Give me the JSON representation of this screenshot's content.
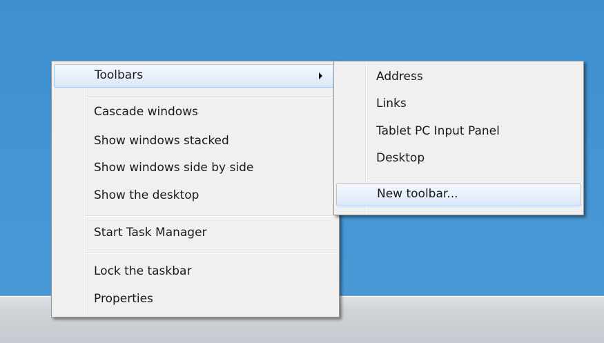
{
  "context_menu": {
    "items": [
      {
        "label": "Toolbars"
      },
      {
        "label": "Cascade windows"
      },
      {
        "label": "Show windows stacked"
      },
      {
        "label": "Show windows side by side"
      },
      {
        "label": "Show the desktop"
      },
      {
        "label": "Start Task Manager"
      },
      {
        "label": "Lock the taskbar"
      },
      {
        "label": "Properties"
      }
    ]
  },
  "toolbars_submenu": {
    "items": [
      {
        "label": "Address"
      },
      {
        "label": "Links"
      },
      {
        "label": "Tablet PC Input Panel"
      },
      {
        "label": "Desktop"
      },
      {
        "label": "New toolbar..."
      }
    ]
  },
  "icons": {
    "submenu_arrow": "submenu-arrow-icon"
  },
  "colors": {
    "desktop_background": "#4596d5",
    "menu_background": "#f0f0f0",
    "hover_border": "#a8c7e8"
  }
}
